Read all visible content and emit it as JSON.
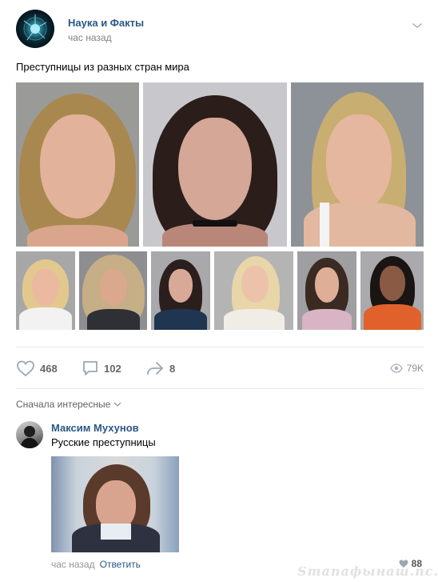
{
  "post": {
    "group_name": "Наука и Факты",
    "time": "час назад",
    "text": "Преступницы из разных стран мира"
  },
  "actions": {
    "likes": "468",
    "comments": "102",
    "shares": "8",
    "views": "79K"
  },
  "comments_section": {
    "sort_label": "Сначала интересные"
  },
  "comment": {
    "author": "Максим Мухунов",
    "text": "Русские преступницы",
    "time": "час назад",
    "reply_label": "Ответить",
    "likes": "88"
  },
  "watermark": "Smanaфынаш.nc.ru",
  "colors": {
    "link": "#2a5885",
    "muted": "#828282",
    "divider": "#e7e8ec"
  }
}
